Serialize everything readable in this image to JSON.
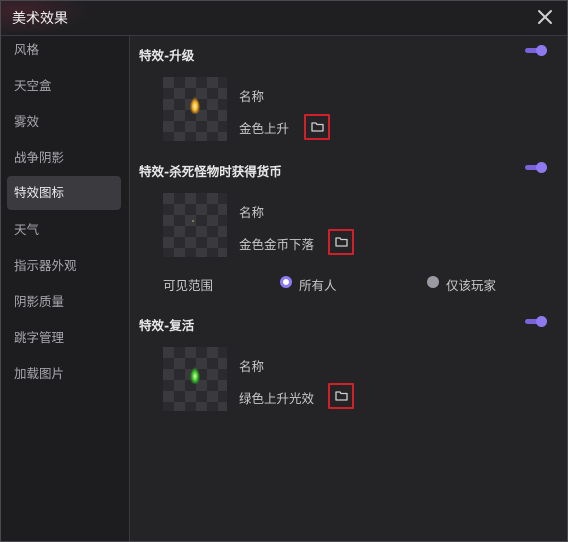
{
  "window": {
    "title": "美术效果"
  },
  "sidebar": {
    "items": [
      {
        "label": "风格"
      },
      {
        "label": "天空盒"
      },
      {
        "label": "雾效"
      },
      {
        "label": "战争阴影"
      },
      {
        "label": "特效图标",
        "active": true
      },
      {
        "label": "天气"
      },
      {
        "label": "指示器外观"
      },
      {
        "label": "阴影质量"
      },
      {
        "label": "跳字管理"
      },
      {
        "label": "加载图片"
      }
    ]
  },
  "sections": [
    {
      "title": "特效-升级",
      "enabled": true,
      "name_label": "名称",
      "value": "金色上升",
      "icon": "gold-flame-icon"
    },
    {
      "title": "特效-杀死怪物时获得货币",
      "enabled": true,
      "name_label": "名称",
      "value": "金色金币下落",
      "icon": "gold-coin-drop-icon"
    },
    {
      "title": "特效-复活",
      "enabled": true,
      "name_label": "名称",
      "value": "绿色上升光效",
      "icon": "green-flame-icon"
    }
  ],
  "visibility": {
    "label": "可见范围",
    "options": [
      {
        "label": "所有人",
        "selected": true
      },
      {
        "label": "仅该玩家",
        "selected": false
      }
    ]
  },
  "colors": {
    "accent": "#7a63d8",
    "highlight_border": "#d0202a"
  }
}
